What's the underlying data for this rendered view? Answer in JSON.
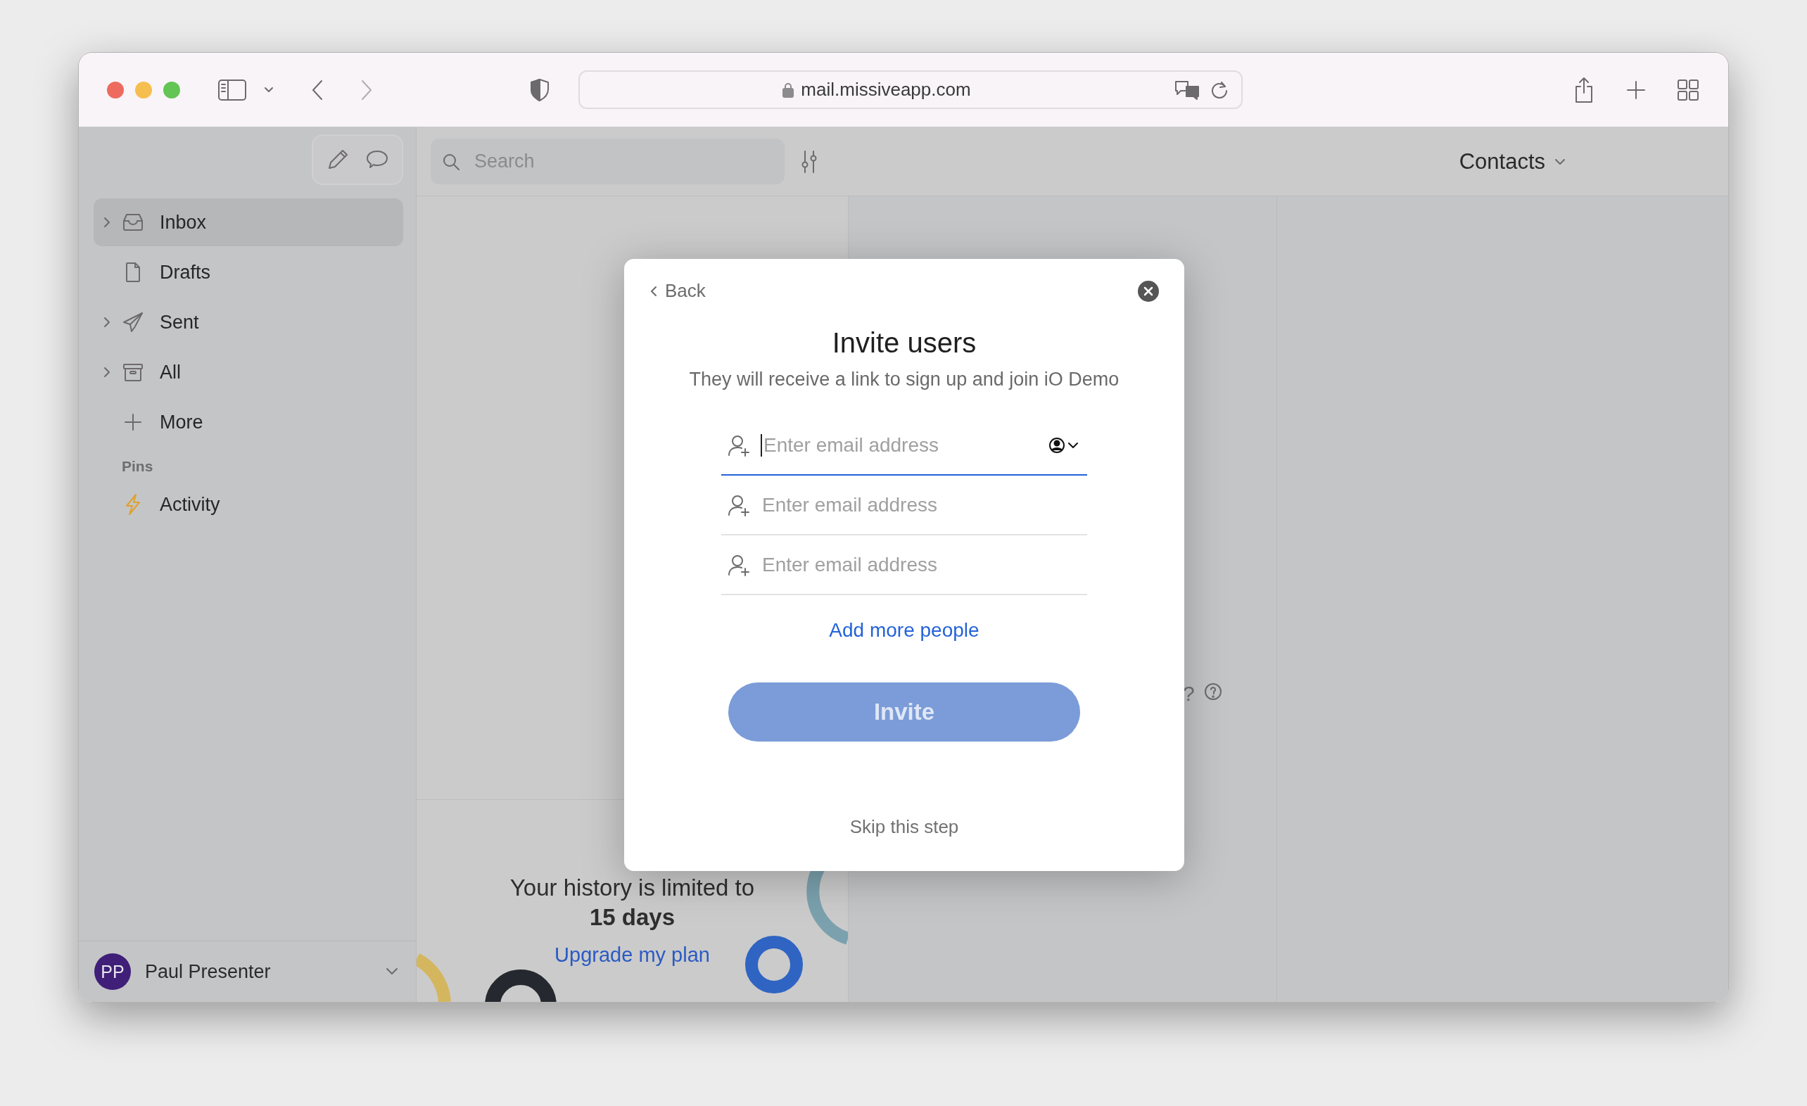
{
  "browser": {
    "url": "mail.missiveapp.com"
  },
  "sidebar": {
    "items": [
      {
        "label": "Inbox",
        "expandable": true,
        "selected": true
      },
      {
        "label": "Drafts",
        "expandable": false,
        "selected": false
      },
      {
        "label": "Sent",
        "expandable": true,
        "selected": false
      },
      {
        "label": "All",
        "expandable": true,
        "selected": false
      },
      {
        "label": "More",
        "expandable": false,
        "selected": false
      }
    ],
    "pins_heading": "Pins",
    "pins": [
      {
        "label": "Activity",
        "expandable": false,
        "selected": false
      }
    ],
    "user": {
      "initials": "PP",
      "name": "Paul Presenter"
    }
  },
  "toolbar": {
    "search_placeholder": "Search",
    "view": "Contacts"
  },
  "help": {
    "text": "?"
  },
  "upsell": {
    "message": "Your history is limited to",
    "highlight": "15 days",
    "link": "Upgrade my plan"
  },
  "modal": {
    "back": "Back",
    "title": "Invite users",
    "subtitle": "They will receive a link to sign up and join iO Demo",
    "fields": [
      {
        "placeholder": "Enter email address",
        "focused": true
      },
      {
        "placeholder": "Enter email address",
        "focused": false
      },
      {
        "placeholder": "Enter email address",
        "focused": false
      }
    ],
    "add_more": "Add more people",
    "invite": {
      "label": "Invite",
      "disabled": true
    },
    "skip": "Skip this step"
  }
}
